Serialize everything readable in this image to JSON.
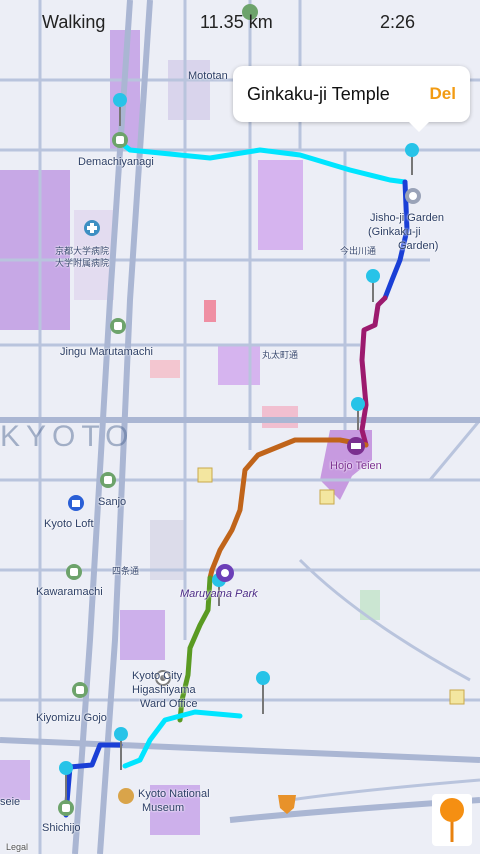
{
  "status_bar": {
    "mode": "Walking",
    "distance": "11.35 km",
    "time": "2:26"
  },
  "callout": {
    "title": "Ginkaku-ji Temple",
    "delete_label": "Del"
  },
  "map": {
    "city_label": "KYOTO",
    "labels": {
      "demachiyanagi": "Demachiyanagi",
      "motoyama": "Mototan",
      "jisho_garden": "Jisho-ji Garden",
      "jisho_garden_sub": "(Ginkaku-ji",
      "jisho_garden_sub2": "Garden)",
      "jingu": "Jingu Marutamachi",
      "sanjo": "Sanjo",
      "kyoto_loft": "Kyoto Loft",
      "kawaramachi": "Kawaramachi",
      "maruyama": "Maruyama Park",
      "hojo": "Hojo Teien",
      "kyoto_city": "Kyoto City",
      "higashiyama": "Higashiyama",
      "ward_office": "Ward Office",
      "kiyomizu": "Kiyomizu Gojo",
      "national_museum": "Kyoto National",
      "museum": "Museum",
      "shichijo": "Shichijo",
      "kyoto_uni": "京都大学病院",
      "kyoto_uni2": "大学附属病院",
      "street1": "丸太町通",
      "street2": "四条通",
      "street3": "今出川通",
      "legal": "Legal",
      "seiei": "seie"
    },
    "route_colors": [
      "#00e5ff",
      "#1a3fd6",
      "#9c1a6e",
      "#c0641a",
      "#5a9a22",
      "#00e5ff",
      "#1a3fd6"
    ],
    "icons": [
      "pin-icon",
      "station-icon",
      "park-icon",
      "temple-icon",
      "hospital-icon",
      "shopping-icon"
    ]
  }
}
